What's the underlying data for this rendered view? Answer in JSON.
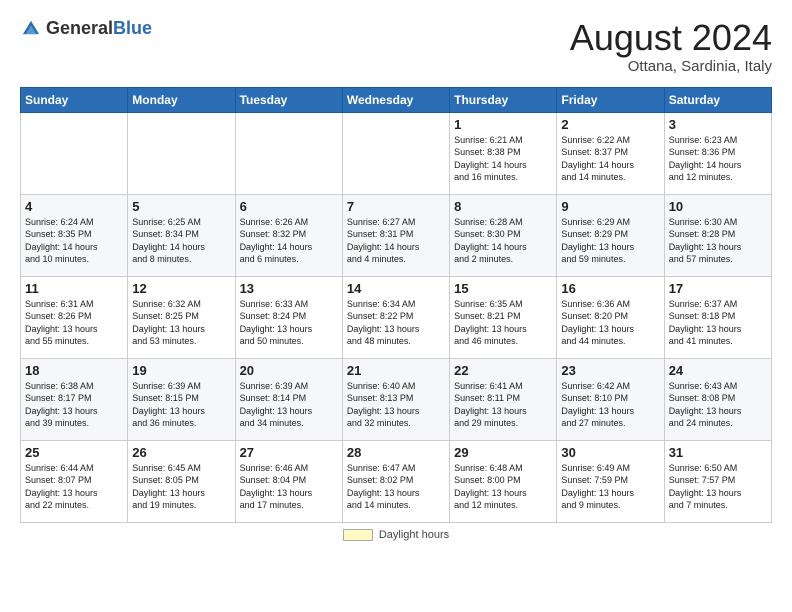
{
  "header": {
    "logo_general": "General",
    "logo_blue": "Blue",
    "month_year": "August 2024",
    "location": "Ottana, Sardinia, Italy"
  },
  "days_of_week": [
    "Sunday",
    "Monday",
    "Tuesday",
    "Wednesday",
    "Thursday",
    "Friday",
    "Saturday"
  ],
  "weeks": [
    [
      {
        "day": "",
        "info": ""
      },
      {
        "day": "",
        "info": ""
      },
      {
        "day": "",
        "info": ""
      },
      {
        "day": "",
        "info": ""
      },
      {
        "day": "1",
        "info": "Sunrise: 6:21 AM\nSunset: 8:38 PM\nDaylight: 14 hours\nand 16 minutes."
      },
      {
        "day": "2",
        "info": "Sunrise: 6:22 AM\nSunset: 8:37 PM\nDaylight: 14 hours\nand 14 minutes."
      },
      {
        "day": "3",
        "info": "Sunrise: 6:23 AM\nSunset: 8:36 PM\nDaylight: 14 hours\nand 12 minutes."
      }
    ],
    [
      {
        "day": "4",
        "info": "Sunrise: 6:24 AM\nSunset: 8:35 PM\nDaylight: 14 hours\nand 10 minutes."
      },
      {
        "day": "5",
        "info": "Sunrise: 6:25 AM\nSunset: 8:34 PM\nDaylight: 14 hours\nand 8 minutes."
      },
      {
        "day": "6",
        "info": "Sunrise: 6:26 AM\nSunset: 8:32 PM\nDaylight: 14 hours\nand 6 minutes."
      },
      {
        "day": "7",
        "info": "Sunrise: 6:27 AM\nSunset: 8:31 PM\nDaylight: 14 hours\nand 4 minutes."
      },
      {
        "day": "8",
        "info": "Sunrise: 6:28 AM\nSunset: 8:30 PM\nDaylight: 14 hours\nand 2 minutes."
      },
      {
        "day": "9",
        "info": "Sunrise: 6:29 AM\nSunset: 8:29 PM\nDaylight: 13 hours\nand 59 minutes."
      },
      {
        "day": "10",
        "info": "Sunrise: 6:30 AM\nSunset: 8:28 PM\nDaylight: 13 hours\nand 57 minutes."
      }
    ],
    [
      {
        "day": "11",
        "info": "Sunrise: 6:31 AM\nSunset: 8:26 PM\nDaylight: 13 hours\nand 55 minutes."
      },
      {
        "day": "12",
        "info": "Sunrise: 6:32 AM\nSunset: 8:25 PM\nDaylight: 13 hours\nand 53 minutes."
      },
      {
        "day": "13",
        "info": "Sunrise: 6:33 AM\nSunset: 8:24 PM\nDaylight: 13 hours\nand 50 minutes."
      },
      {
        "day": "14",
        "info": "Sunrise: 6:34 AM\nSunset: 8:22 PM\nDaylight: 13 hours\nand 48 minutes."
      },
      {
        "day": "15",
        "info": "Sunrise: 6:35 AM\nSunset: 8:21 PM\nDaylight: 13 hours\nand 46 minutes."
      },
      {
        "day": "16",
        "info": "Sunrise: 6:36 AM\nSunset: 8:20 PM\nDaylight: 13 hours\nand 44 minutes."
      },
      {
        "day": "17",
        "info": "Sunrise: 6:37 AM\nSunset: 8:18 PM\nDaylight: 13 hours\nand 41 minutes."
      }
    ],
    [
      {
        "day": "18",
        "info": "Sunrise: 6:38 AM\nSunset: 8:17 PM\nDaylight: 13 hours\nand 39 minutes."
      },
      {
        "day": "19",
        "info": "Sunrise: 6:39 AM\nSunset: 8:15 PM\nDaylight: 13 hours\nand 36 minutes."
      },
      {
        "day": "20",
        "info": "Sunrise: 6:39 AM\nSunset: 8:14 PM\nDaylight: 13 hours\nand 34 minutes."
      },
      {
        "day": "21",
        "info": "Sunrise: 6:40 AM\nSunset: 8:13 PM\nDaylight: 13 hours\nand 32 minutes."
      },
      {
        "day": "22",
        "info": "Sunrise: 6:41 AM\nSunset: 8:11 PM\nDaylight: 13 hours\nand 29 minutes."
      },
      {
        "day": "23",
        "info": "Sunrise: 6:42 AM\nSunset: 8:10 PM\nDaylight: 13 hours\nand 27 minutes."
      },
      {
        "day": "24",
        "info": "Sunrise: 6:43 AM\nSunset: 8:08 PM\nDaylight: 13 hours\nand 24 minutes."
      }
    ],
    [
      {
        "day": "25",
        "info": "Sunrise: 6:44 AM\nSunset: 8:07 PM\nDaylight: 13 hours\nand 22 minutes."
      },
      {
        "day": "26",
        "info": "Sunrise: 6:45 AM\nSunset: 8:05 PM\nDaylight: 13 hours\nand 19 minutes."
      },
      {
        "day": "27",
        "info": "Sunrise: 6:46 AM\nSunset: 8:04 PM\nDaylight: 13 hours\nand 17 minutes."
      },
      {
        "day": "28",
        "info": "Sunrise: 6:47 AM\nSunset: 8:02 PM\nDaylight: 13 hours\nand 14 minutes."
      },
      {
        "day": "29",
        "info": "Sunrise: 6:48 AM\nSunset: 8:00 PM\nDaylight: 13 hours\nand 12 minutes."
      },
      {
        "day": "30",
        "info": "Sunrise: 6:49 AM\nSunset: 7:59 PM\nDaylight: 13 hours\nand 9 minutes."
      },
      {
        "day": "31",
        "info": "Sunrise: 6:50 AM\nSunset: 7:57 PM\nDaylight: 13 hours\nand 7 minutes."
      }
    ]
  ],
  "footer": {
    "daylight_label": "Daylight hours",
    "swatch_color": "#f5f5a0"
  }
}
